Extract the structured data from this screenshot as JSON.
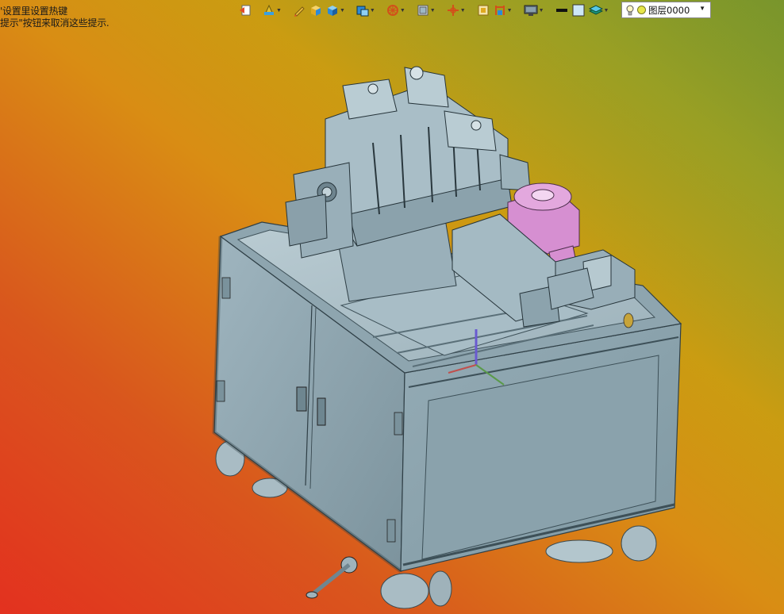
{
  "hints": {
    "line1": "'设置里设置热键",
    "line2": "提示\"按钮来取消这些提示."
  },
  "toolbar": {
    "buttons": [
      {
        "name": "previous-view-icon",
        "dropdown": false
      },
      {
        "name": "section-view-icon",
        "dropdown": true
      },
      {
        "name": "sketch-pen-icon",
        "dropdown": false
      },
      {
        "name": "part-cube-icon",
        "dropdown": false
      },
      {
        "name": "view-cube-icon",
        "dropdown": true
      },
      {
        "name": "display-style-icon",
        "dropdown": true
      },
      {
        "name": "hide-show-icon",
        "dropdown": true
      },
      {
        "name": "view-orientation-icon",
        "dropdown": true
      },
      {
        "name": "triad-icon",
        "dropdown": true
      },
      {
        "name": "zoom-area-icon",
        "dropdown": false
      },
      {
        "name": "dimension-icon",
        "dropdown": true
      },
      {
        "name": "monitor-icon",
        "dropdown": true
      },
      {
        "name": "line-style-icon",
        "dropdown": false
      },
      {
        "name": "color-swatch-icon",
        "dropdown": false
      },
      {
        "name": "layers-icon",
        "dropdown": true
      }
    ]
  },
  "layer": {
    "current": "图层0000",
    "lamp_icon": "lightbulb-icon",
    "color": "#e7e64a"
  },
  "colors": {
    "machine_body": "#8fa6b0",
    "machine_dark": "#5f7680",
    "highlight_part": "#d68fd1"
  }
}
